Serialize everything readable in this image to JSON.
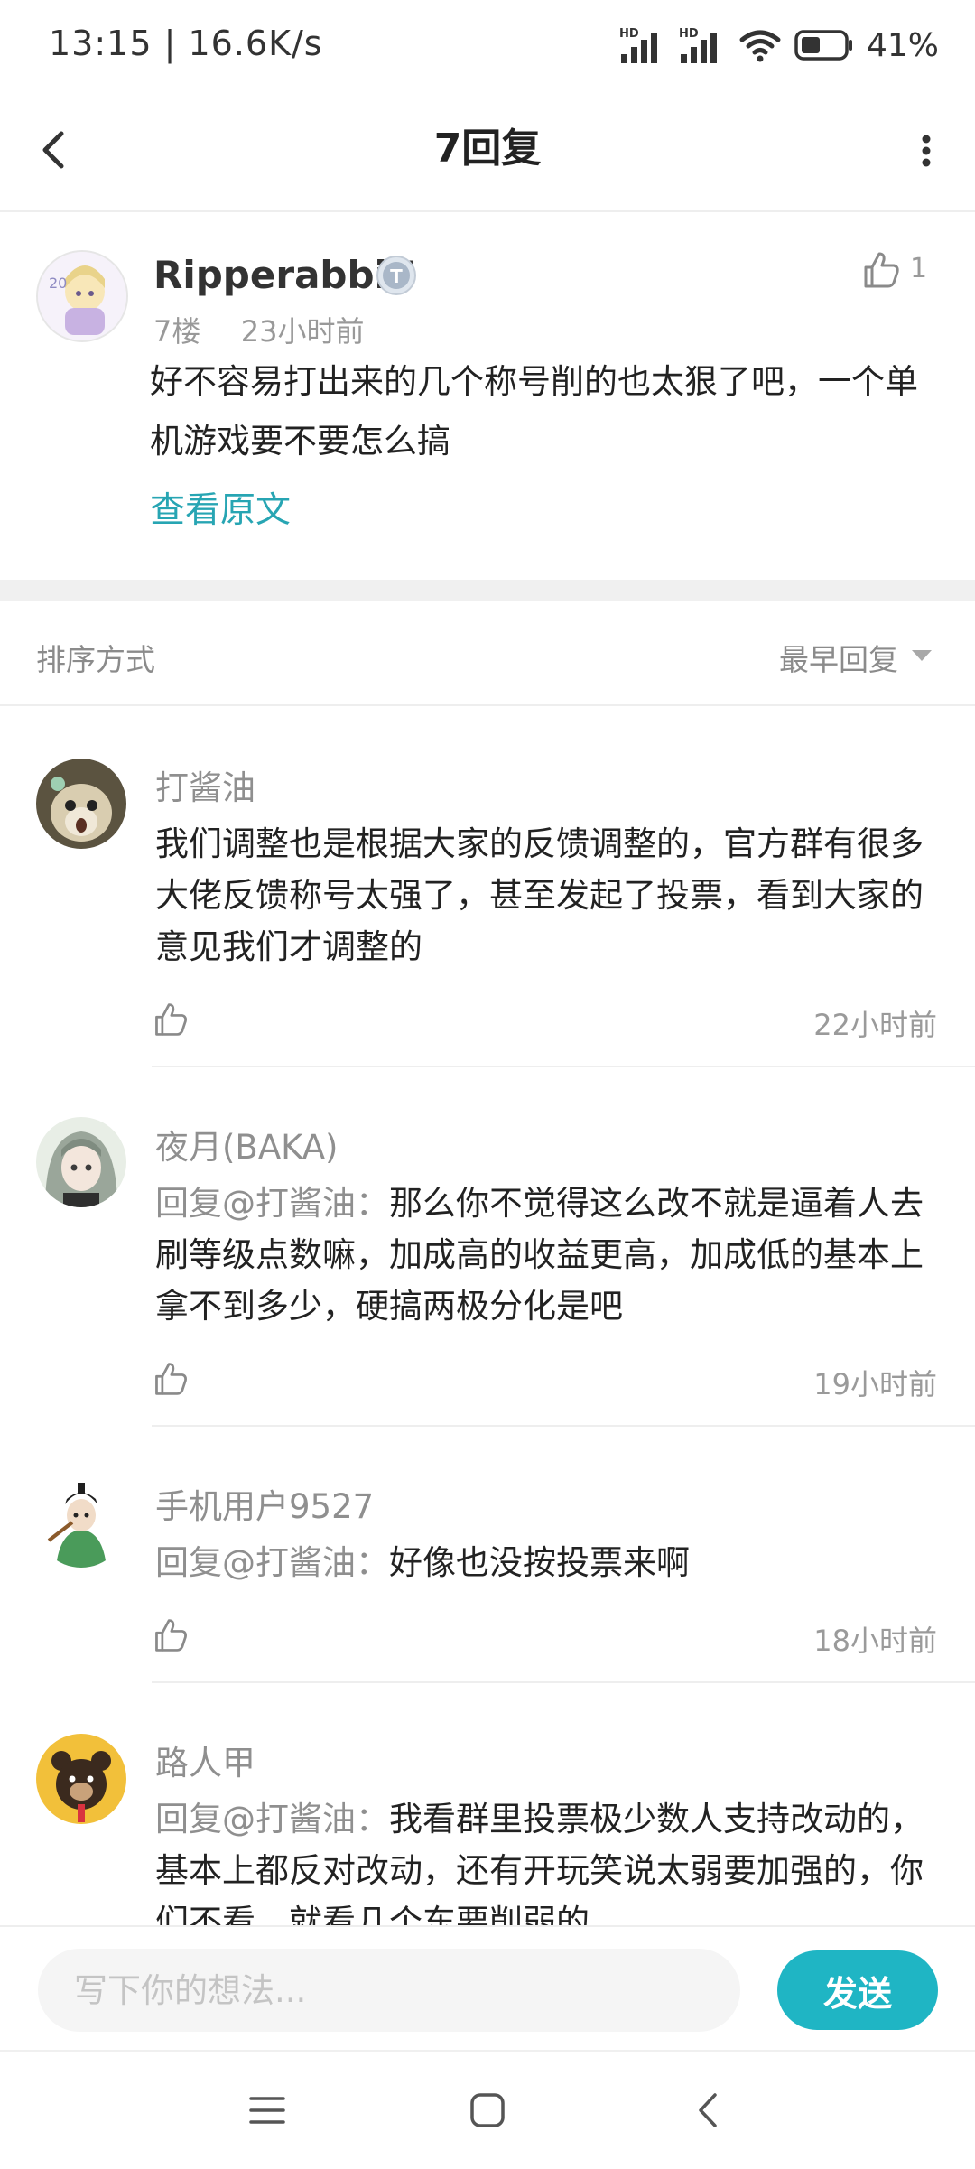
{
  "status_bar": {
    "time": "13:15 | 16.6K/s",
    "signal1_label": "HD",
    "signal2_label": "HD",
    "battery": "41%"
  },
  "header": {
    "title": "7回复"
  },
  "post": {
    "username": "RipperabbiT",
    "badge": "T",
    "likes": "1",
    "floor": "7楼",
    "time": "23小时前",
    "content": "好不容易打出来的几个称号削的也太狠了吧，一个单机游戏要不要怎么搞",
    "view_original": "查看原文"
  },
  "sort": {
    "label": "排序方式",
    "value": "最早回复"
  },
  "comments": [
    {
      "name": "打酱油",
      "mention": "",
      "text": "我们调整也是根据大家的反馈调整的，官方群有很多大佬反馈称号太强了，甚至发起了投票，看到大家的意见我们才调整的",
      "time": "22小时前"
    },
    {
      "name": "夜月(BAKA)",
      "mention": "回复@打酱油：",
      "text": "那么你不觉得这么改不就是逼着人去刷等级点数嘛，加成高的收益更高，加成低的基本上拿不到多少，硬搞两极分化是吧",
      "time": "19小时前"
    },
    {
      "name": "手机用户9527",
      "mention": "回复@打酱油：",
      "text": "好像也没按投票来啊",
      "time": "18小时前"
    },
    {
      "name": "路人甲",
      "mention": "回复@打酱油：",
      "text": "我看群里投票极少数人支持改动的，基本上都反对改动，还有开玩笑说太弱要加强的，你们不看，就看几个东要削弱的",
      "time": ""
    }
  ],
  "composer": {
    "placeholder": "写下你的想法...",
    "send_label": "发送"
  },
  "colors": {
    "accent": "#1fb5c4",
    "link": "#27a5b3"
  }
}
